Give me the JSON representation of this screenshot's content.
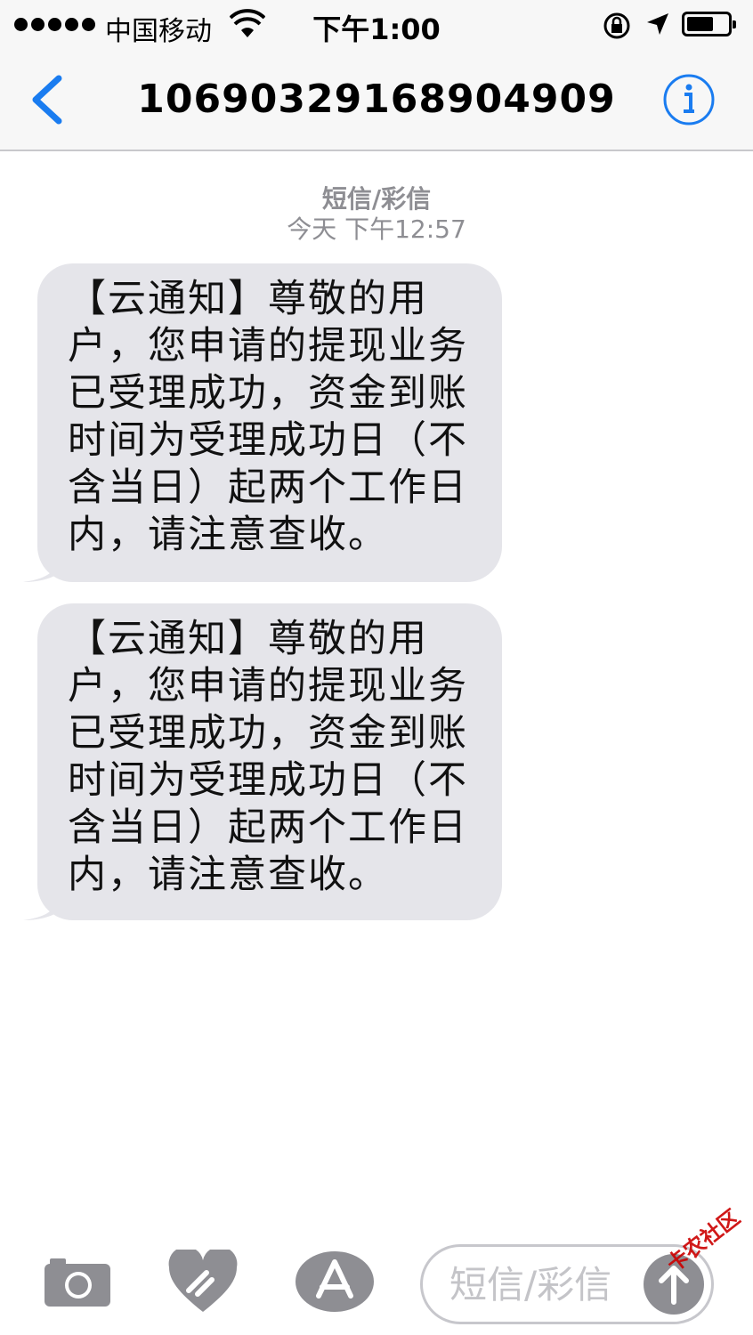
{
  "status_bar": {
    "carrier": "中国移动",
    "time": "下午1:00",
    "battery_level": 0.58,
    "icons": [
      "signal-dots-icon",
      "wifi-icon",
      "orientation-lock-icon",
      "location-arrow-icon",
      "battery-icon"
    ]
  },
  "nav": {
    "title": "10690329168904909",
    "back_icon": "chevron-left-icon",
    "info_icon": "info-icon",
    "accent_color": "#1a7cf0"
  },
  "thread": {
    "type_label": "短信/彩信",
    "timestamp": "今天 下午12:57",
    "messages": [
      {
        "lines": [
          "【云通知】尊敬的用",
          "户，您申请的提现业务",
          "已受理成功，资金到账",
          "时间为受理成功日（不",
          "含当日）起两个工作日",
          "内，请注意查收。"
        ]
      },
      {
        "lines": [
          "【云通知】尊敬的用",
          "户，您申请的提现业务",
          "已受理成功，资金到账",
          "时间为受理成功日（不",
          "含当日）起两个工作日",
          "内，请注意查收。"
        ]
      }
    ]
  },
  "toolbar": {
    "icons": [
      "camera-icon",
      "digital-touch-icon",
      "app-store-icon"
    ],
    "composer_placeholder": "短信/彩信",
    "send_icon": "arrow-up-icon"
  },
  "watermark": "卡农社区"
}
